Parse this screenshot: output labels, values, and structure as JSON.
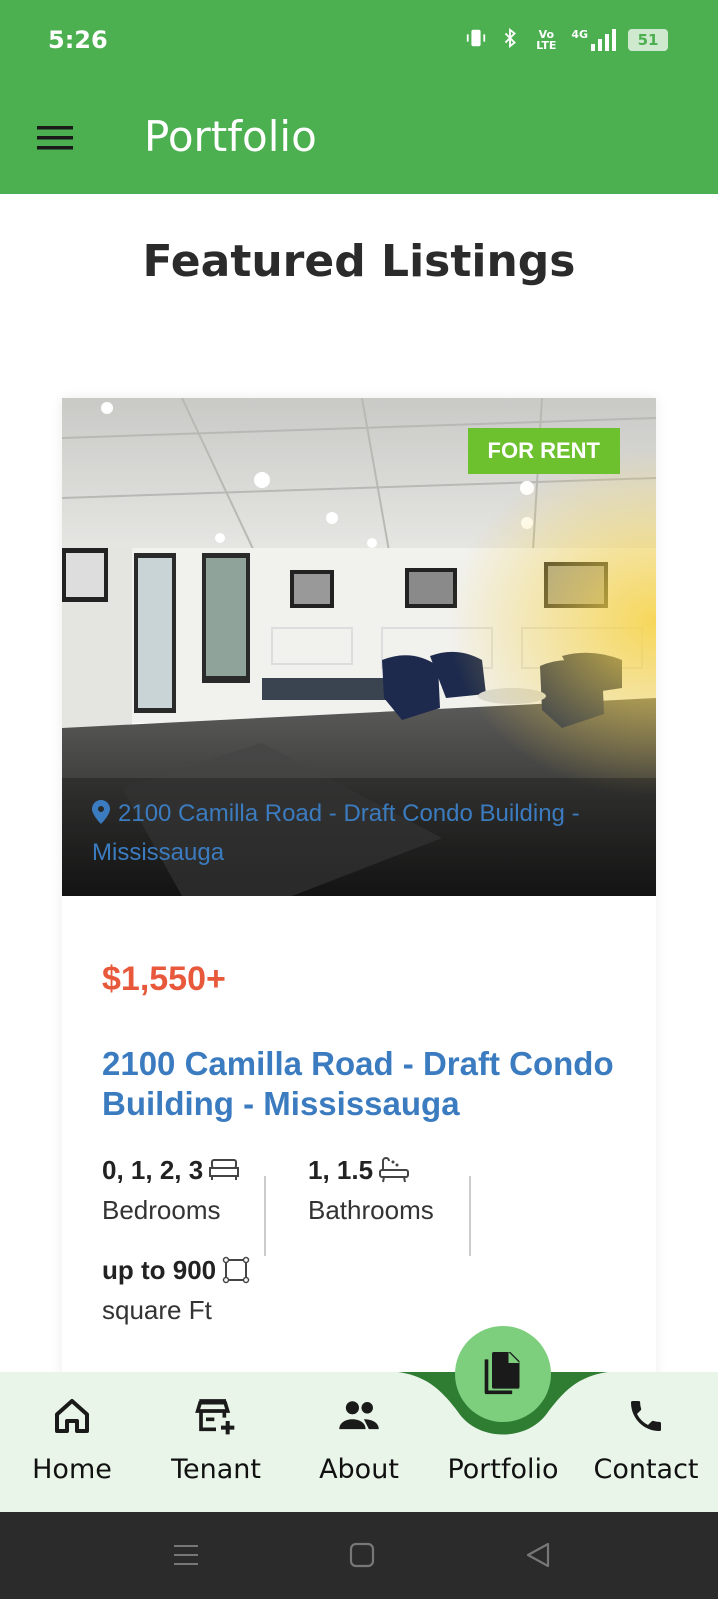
{
  "status_bar": {
    "time": "5:26",
    "network": "4G",
    "volte": "Vo LTE",
    "battery": "51"
  },
  "app_bar": {
    "title": "Portfolio"
  },
  "page": {
    "heading": "Featured Listings"
  },
  "listing": {
    "badge": "FOR RENT",
    "photo_location": "2100 Camilla Road - Draft Condo Building - Mississauga",
    "price": "$1,550+",
    "title": "2100 Camilla Road - Draft Condo Building - Mississauga",
    "bedrooms_value": "0, 1, 2, 3",
    "bedrooms_label": "Bedrooms",
    "bathrooms_value": "1, 1.5",
    "bathrooms_label": "Bathrooms",
    "area_value": "up to 900",
    "area_label": "square Ft"
  },
  "bottom_nav": {
    "items": [
      {
        "label": "Home",
        "icon": "home-icon"
      },
      {
        "label": "Tenant",
        "icon": "store-add-icon"
      },
      {
        "label": "About",
        "icon": "people-icon"
      },
      {
        "label": "Portfolio",
        "icon": "documents-icon",
        "active": true
      },
      {
        "label": "Contact",
        "icon": "phone-icon"
      }
    ]
  },
  "colors": {
    "primary": "#4caf50",
    "badge": "#6ec12e",
    "price": "#e8593c",
    "link": "#3b7bbf",
    "nav_bg": "#e9f5e9",
    "fab": "#7dce7d",
    "notch": "#2e7d32"
  }
}
